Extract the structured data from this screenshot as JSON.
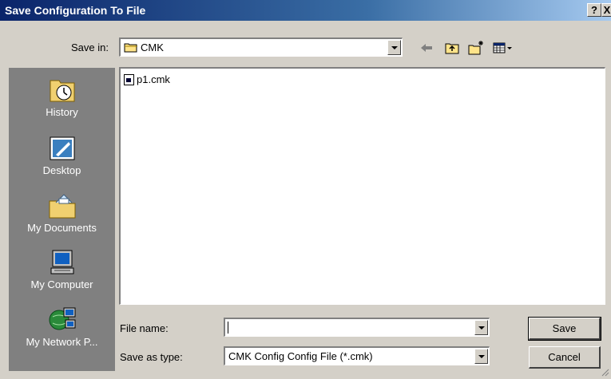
{
  "window": {
    "title": "Save Configuration To File",
    "help_label": "?",
    "close_label": "X"
  },
  "toolbar": {
    "save_in_label": "Save in:",
    "save_in_value": "CMK",
    "icons": [
      "back-arrow-icon",
      "up-folder-icon",
      "new-folder-icon",
      "view-menu-icon"
    ]
  },
  "places": [
    {
      "label": "History",
      "icon": "history-icon"
    },
    {
      "label": "Desktop",
      "icon": "desktop-icon"
    },
    {
      "label": "My Documents",
      "icon": "my-documents-icon"
    },
    {
      "label": "My Computer",
      "icon": "my-computer-icon"
    },
    {
      "label": "My Network P...",
      "icon": "my-network-places-icon"
    }
  ],
  "files": [
    {
      "name": "p1.cmk"
    }
  ],
  "form": {
    "file_name_label": "File name:",
    "file_name_value": "",
    "save_as_type_label": "Save as type:",
    "save_as_type_value": "CMK Config  Config File (*.cmk)"
  },
  "buttons": {
    "save_label": "Save",
    "cancel_label": "Cancel"
  },
  "colors": {
    "title_bar": "#0a246a",
    "face": "#d4d0c8",
    "places_bar": "#808080"
  }
}
